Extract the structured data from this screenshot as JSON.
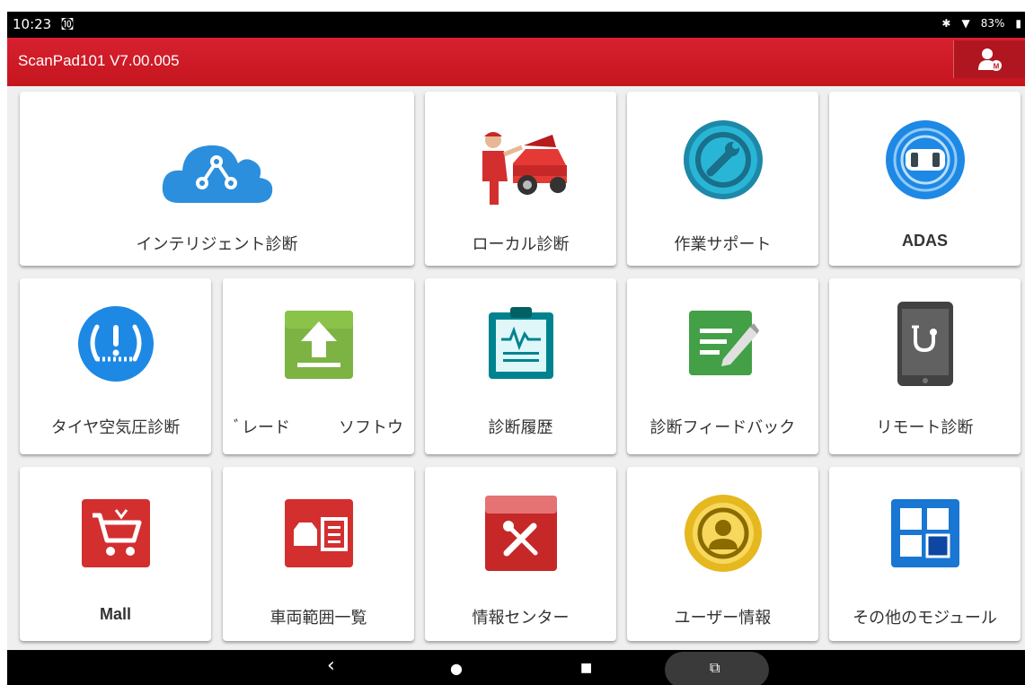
{
  "status_bar": {
    "time": "10:23",
    "battery": "83%"
  },
  "app_bar": {
    "title": "ScanPad101 V7.00.005"
  },
  "tiles": [
    {
      "label": "インテリジェント診断",
      "icon": "cloud-network-icon"
    },
    {
      "label": "ローカル診断",
      "icon": "mechanic-car-icon"
    },
    {
      "label": "作業サポート",
      "icon": "wrench-refresh-icon"
    },
    {
      "label": "ADAS",
      "icon": "car-radar-icon"
    },
    {
      "label": "タイヤ空気圧診断",
      "icon": "tire-pressure-icon"
    },
    {
      "label": "ソフトウェアアップグレード",
      "visible_label": "ﾞレード　　　ソフトウ",
      "icon": "upload-icon"
    },
    {
      "label": "診断履歴",
      "icon": "clipboard-waveform-icon"
    },
    {
      "label": "診断フィードバック",
      "icon": "edit-note-icon"
    },
    {
      "label": "リモート診断",
      "icon": "tablet-stethoscope-icon"
    },
    {
      "label": "Mall",
      "icon": "shopping-cart-icon"
    },
    {
      "label": "車両範囲一覧",
      "icon": "vehicle-list-icon"
    },
    {
      "label": "情報センター",
      "icon": "book-tools-icon"
    },
    {
      "label": "ユーザー情報",
      "icon": "user-circle-icon"
    },
    {
      "label": "その他のモジュール",
      "icon": "modules-grid-icon"
    }
  ],
  "nav": {
    "back": "‹",
    "home": "●",
    "recents": "■"
  },
  "colors": {
    "app_bar": "#d21b28",
    "accent_blue": "#1e88e5"
  }
}
